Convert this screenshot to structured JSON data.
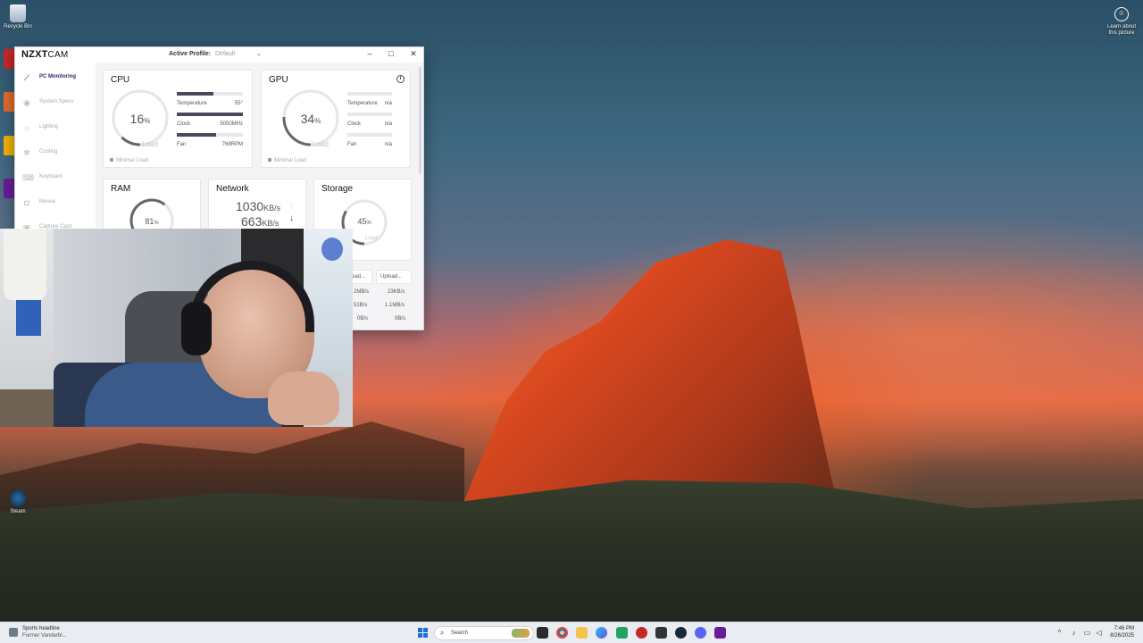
{
  "desktop": {
    "recycle_bin": "Recycle Bin",
    "steam": "Steam",
    "learn_line1": "Learn about",
    "learn_line2": "this picture"
  },
  "app": {
    "brand_bold": "NZXT",
    "brand_light": "CAM",
    "active_profile_label": "Active Profile:",
    "active_profile_value": "Default"
  },
  "sidebar": {
    "items": [
      {
        "label": "PC Monitoring",
        "icon": "chart-line-icon"
      },
      {
        "label": "System Specs",
        "icon": "eye-icon"
      },
      {
        "label": "Lighting",
        "icon": "sun-icon"
      },
      {
        "label": "Cooling",
        "icon": "fan-icon"
      },
      {
        "label": "Keyboard",
        "icon": "keyboard-icon"
      },
      {
        "label": "Mouse",
        "icon": "mouse-icon"
      },
      {
        "label": "Capture Card",
        "icon": "capture-icon"
      }
    ]
  },
  "cpu": {
    "title": "CPU",
    "load_value": "16",
    "load_unit": "%",
    "load_fraction": 0.16,
    "load_label": "Load",
    "temperature_label": "Temperature",
    "temperature_value": "55°",
    "temperature_fraction": 0.55,
    "clock_label": "Clock",
    "clock_value": "5050MHz",
    "clock_fraction": 1.0,
    "fan_label": "Fan",
    "fan_value": "768RPM",
    "fan_fraction": 0.6,
    "status": "Minimal Load"
  },
  "gpu": {
    "title": "GPU",
    "load_value": "34",
    "load_unit": "%",
    "load_fraction": 0.34,
    "load_label": "Load",
    "temperature_label": "Temperature",
    "temperature_value": "n/a",
    "clock_label": "Clock",
    "clock_value": "n/a",
    "fan_label": "Fan",
    "fan_value": "n/a",
    "status": "Minimal Load"
  },
  "ram": {
    "title": "RAM",
    "load_value": "81",
    "load_unit": "%",
    "load_fraction": 0.81
  },
  "network": {
    "title": "Network",
    "download_value": "1030",
    "download_unit": "KB/s",
    "upload_value": "663",
    "upload_unit": "KB/s"
  },
  "storage": {
    "title": "Storage",
    "load_value": "45",
    "load_unit": "%",
    "load_fraction": 0.45,
    "load_label": "Load",
    "col_read": "ead...",
    "col_upload": "Upload...",
    "rows": [
      {
        "read": "2MB/s",
        "write": "23KB/s"
      },
      {
        "read": "51B/s",
        "write": "1.1MB/s"
      },
      {
        "read": "0B/s",
        "write": "0B/s"
      }
    ]
  },
  "taskbar": {
    "news_title": "Sports headline",
    "news_sub": "Former Vanderbi...",
    "search_placeholder": "Search",
    "time": "7:46 PM",
    "date": "8/26/2025"
  },
  "colors": {
    "accent": "#2b2b6a",
    "bar_fill": "#4a4a5c",
    "gauge_track": "#e6e6ea",
    "gauge_fill": "#666670"
  }
}
